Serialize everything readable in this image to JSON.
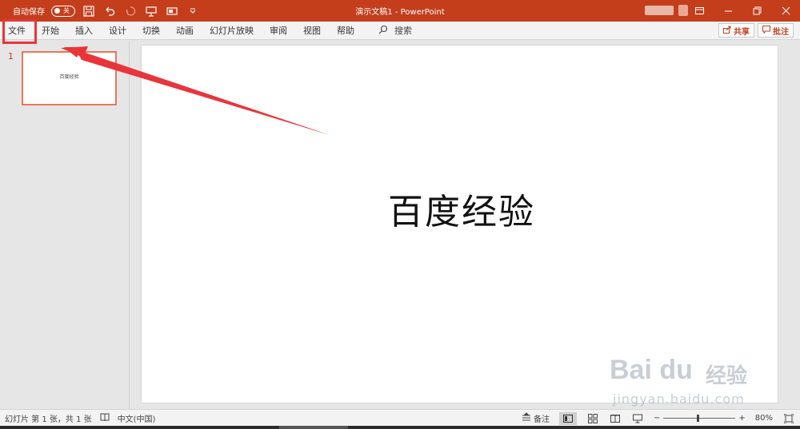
{
  "titlebar": {
    "autosave_label": "自动保存",
    "autosave_state": "关",
    "document_title": "演示文稿1  -  PowerPoint"
  },
  "ribbon": {
    "tabs": [
      "文件",
      "开始",
      "插入",
      "设计",
      "切换",
      "动画",
      "幻灯片放映",
      "审阅",
      "视图",
      "帮助"
    ],
    "search_label": "搜索",
    "share_label": "共享",
    "comment_label": "批注"
  },
  "thumbnails": [
    {
      "number": "1",
      "text": "百度经验"
    }
  ],
  "slide": {
    "title": "百度经验"
  },
  "statusbar": {
    "slide_info": "幻灯片 第 1 张，共 1 张",
    "language": "中文(中国)",
    "notes_label": "备注",
    "zoom": "80%"
  },
  "watermark": {
    "brand": "Bai du",
    "brand_cn": "经验",
    "url": "jingyan.baidu.com"
  },
  "colors": {
    "accent": "#c43e1c",
    "annotation": "#e8353a"
  }
}
